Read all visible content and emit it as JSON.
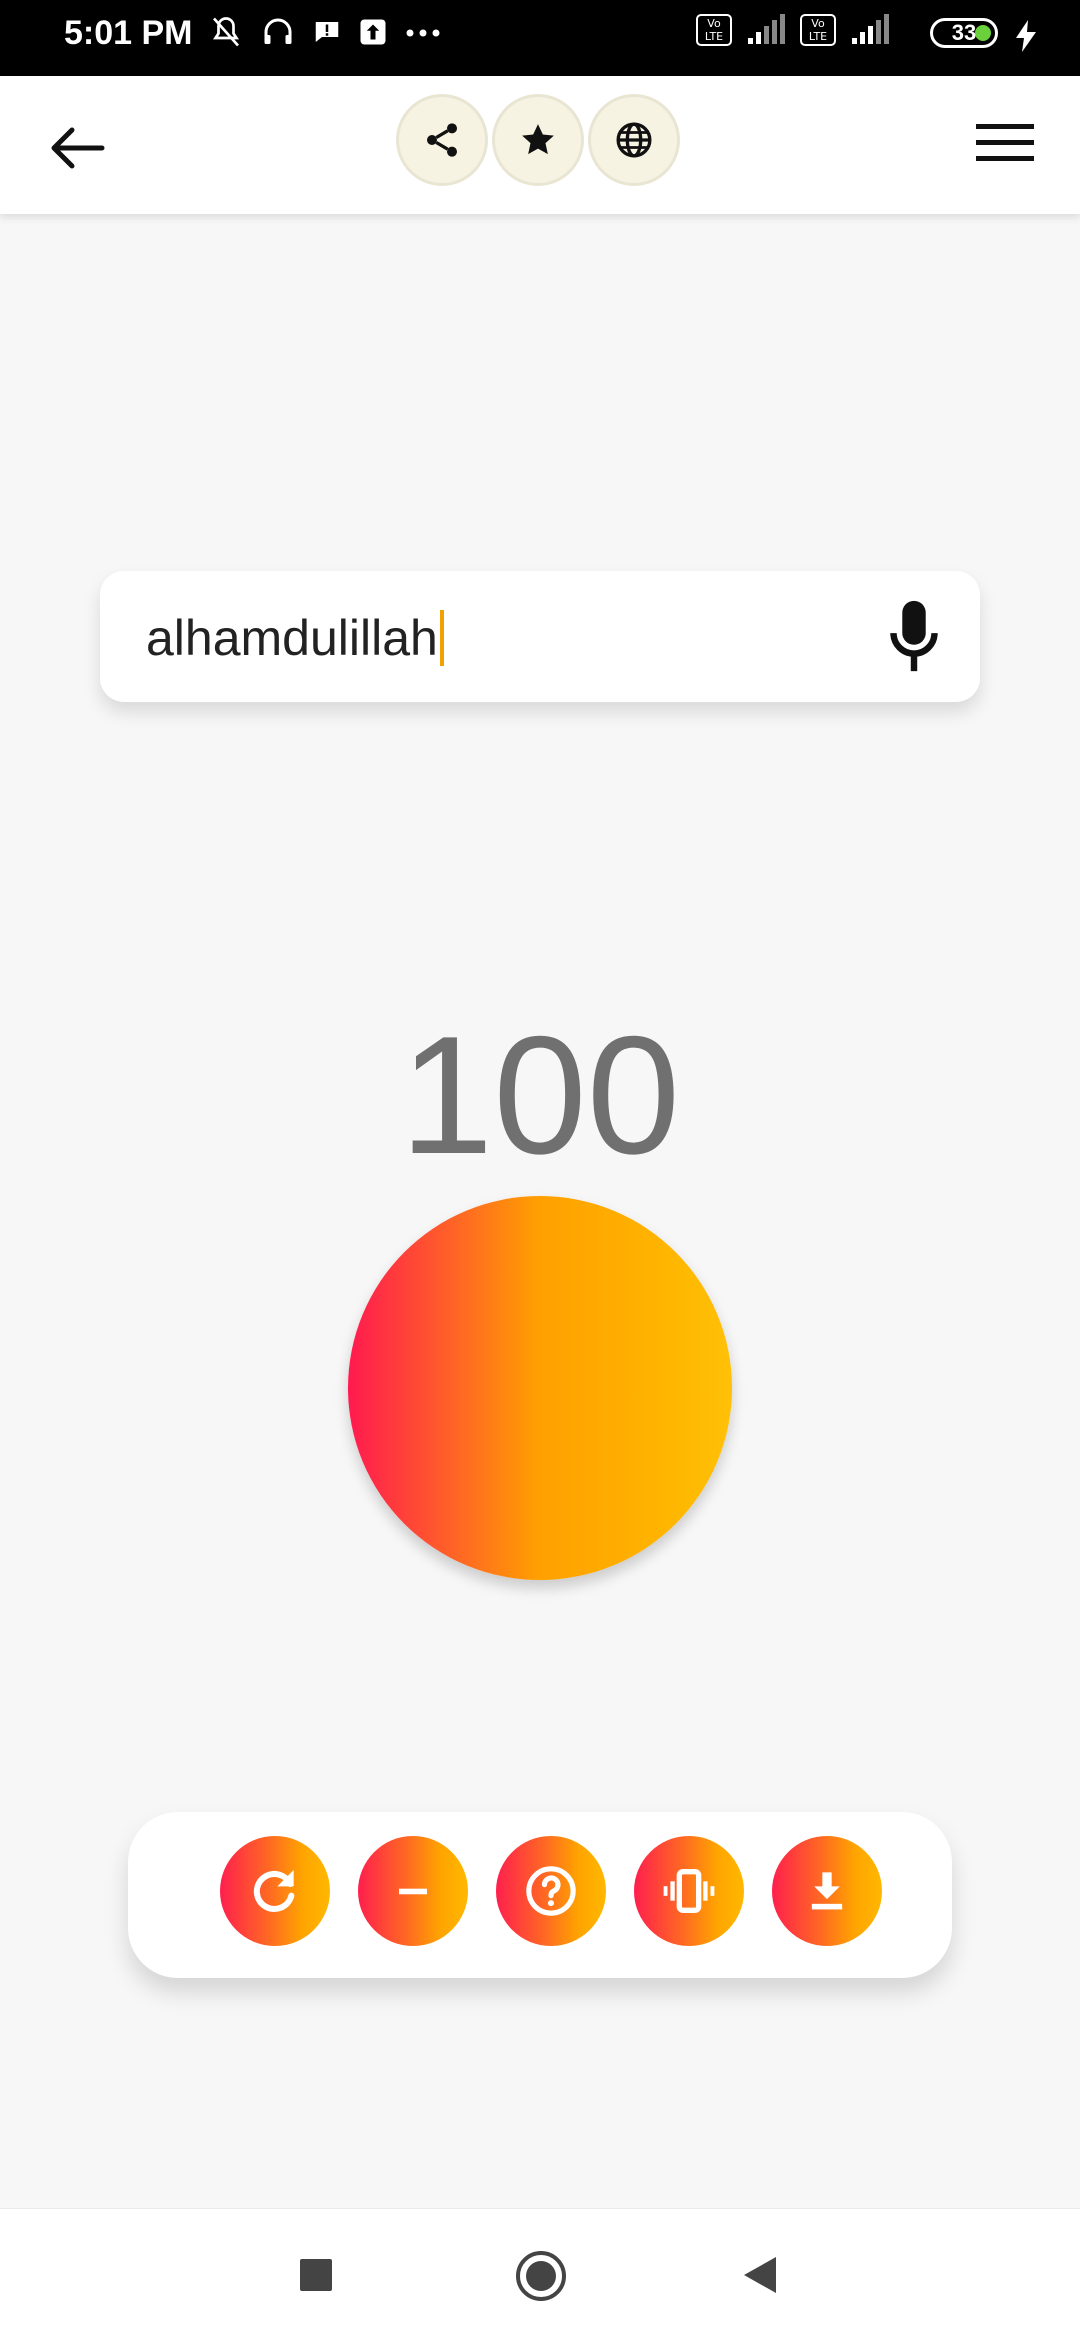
{
  "status_bar": {
    "time": "5:01 PM",
    "battery": "33",
    "icons": [
      "mute-icon",
      "headset-icon",
      "alert-icon",
      "upload-icon",
      "more-icon",
      "volte-icon",
      "signal-icon",
      "volte-icon",
      "signal-icon",
      "charging-icon"
    ]
  },
  "toolbar": {
    "back_icon": "arrow-left-icon",
    "actions": [
      "share-icon",
      "star-icon",
      "globe-icon"
    ],
    "menu_icon": "hamburger-icon"
  },
  "dhikr_input": {
    "value": "alhamdulillah",
    "mic_icon": "microphone-icon"
  },
  "counter": {
    "value": "100"
  },
  "action_bar": {
    "buttons": [
      "refresh-icon",
      "minus-icon",
      "help-icon",
      "vibrate-icon",
      "download-icon"
    ]
  },
  "nav_bar": {
    "items": [
      "recents-icon",
      "home-icon",
      "back-icon"
    ]
  },
  "colors": {
    "gradient_start": "#ff1a4f",
    "gradient_end": "#ffc107",
    "caret": "#f2a200",
    "counter_text": "#707070"
  }
}
